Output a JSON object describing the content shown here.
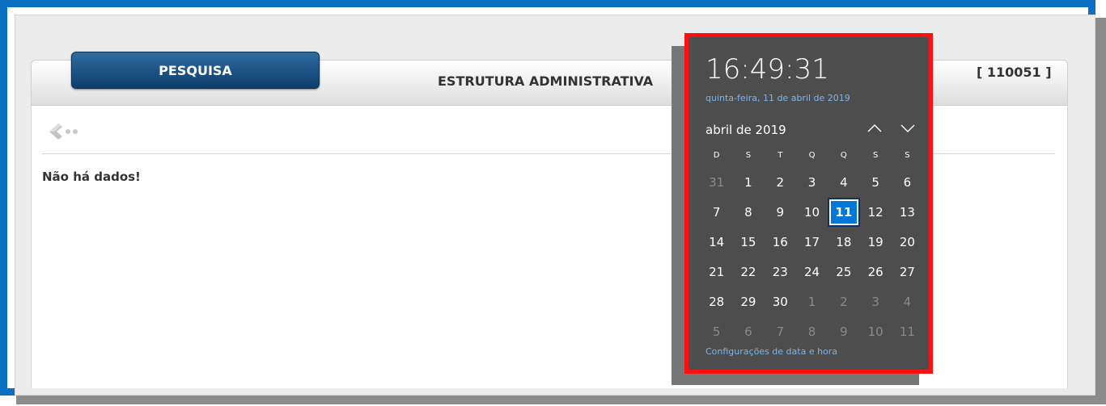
{
  "header": {
    "tab_label": "PESQUISA",
    "title": "ESTRUTURA ADMINISTRATIVA",
    "code": "[ 110051 ]"
  },
  "content": {
    "back_icon": "back-arrow-icon",
    "empty_message": "Não há dados!"
  },
  "calendar": {
    "time": "16:49:31",
    "date_long": "quinta-feira, 11 de abril de 2019",
    "month_label": "abril de 2019",
    "nav_up_icon": "chevron-up-icon",
    "nav_down_icon": "chevron-down-icon",
    "weekdays": [
      "D",
      "S",
      "T",
      "Q",
      "Q",
      "S",
      "S"
    ],
    "weeks": [
      [
        "31",
        "1",
        "2",
        "3",
        "4",
        "5",
        "6"
      ],
      [
        "7",
        "8",
        "9",
        "10",
        "11",
        "12",
        "13"
      ],
      [
        "14",
        "15",
        "16",
        "17",
        "18",
        "19",
        "20"
      ],
      [
        "21",
        "22",
        "23",
        "24",
        "25",
        "26",
        "27"
      ],
      [
        "28",
        "29",
        "30",
        "1",
        "2",
        "3",
        "4"
      ],
      [
        "5",
        "6",
        "7",
        "8",
        "9",
        "10",
        "11"
      ]
    ],
    "selected_day": "11",
    "settings_link": "Configurações de data e hora"
  },
  "colors": {
    "frame_blue": "#0a6ec1",
    "highlight_red": "#ff0f0f",
    "tab_blue": "#0e3e6c",
    "selected_blue": "#0078d7",
    "link_blue": "#7bb5ef"
  }
}
